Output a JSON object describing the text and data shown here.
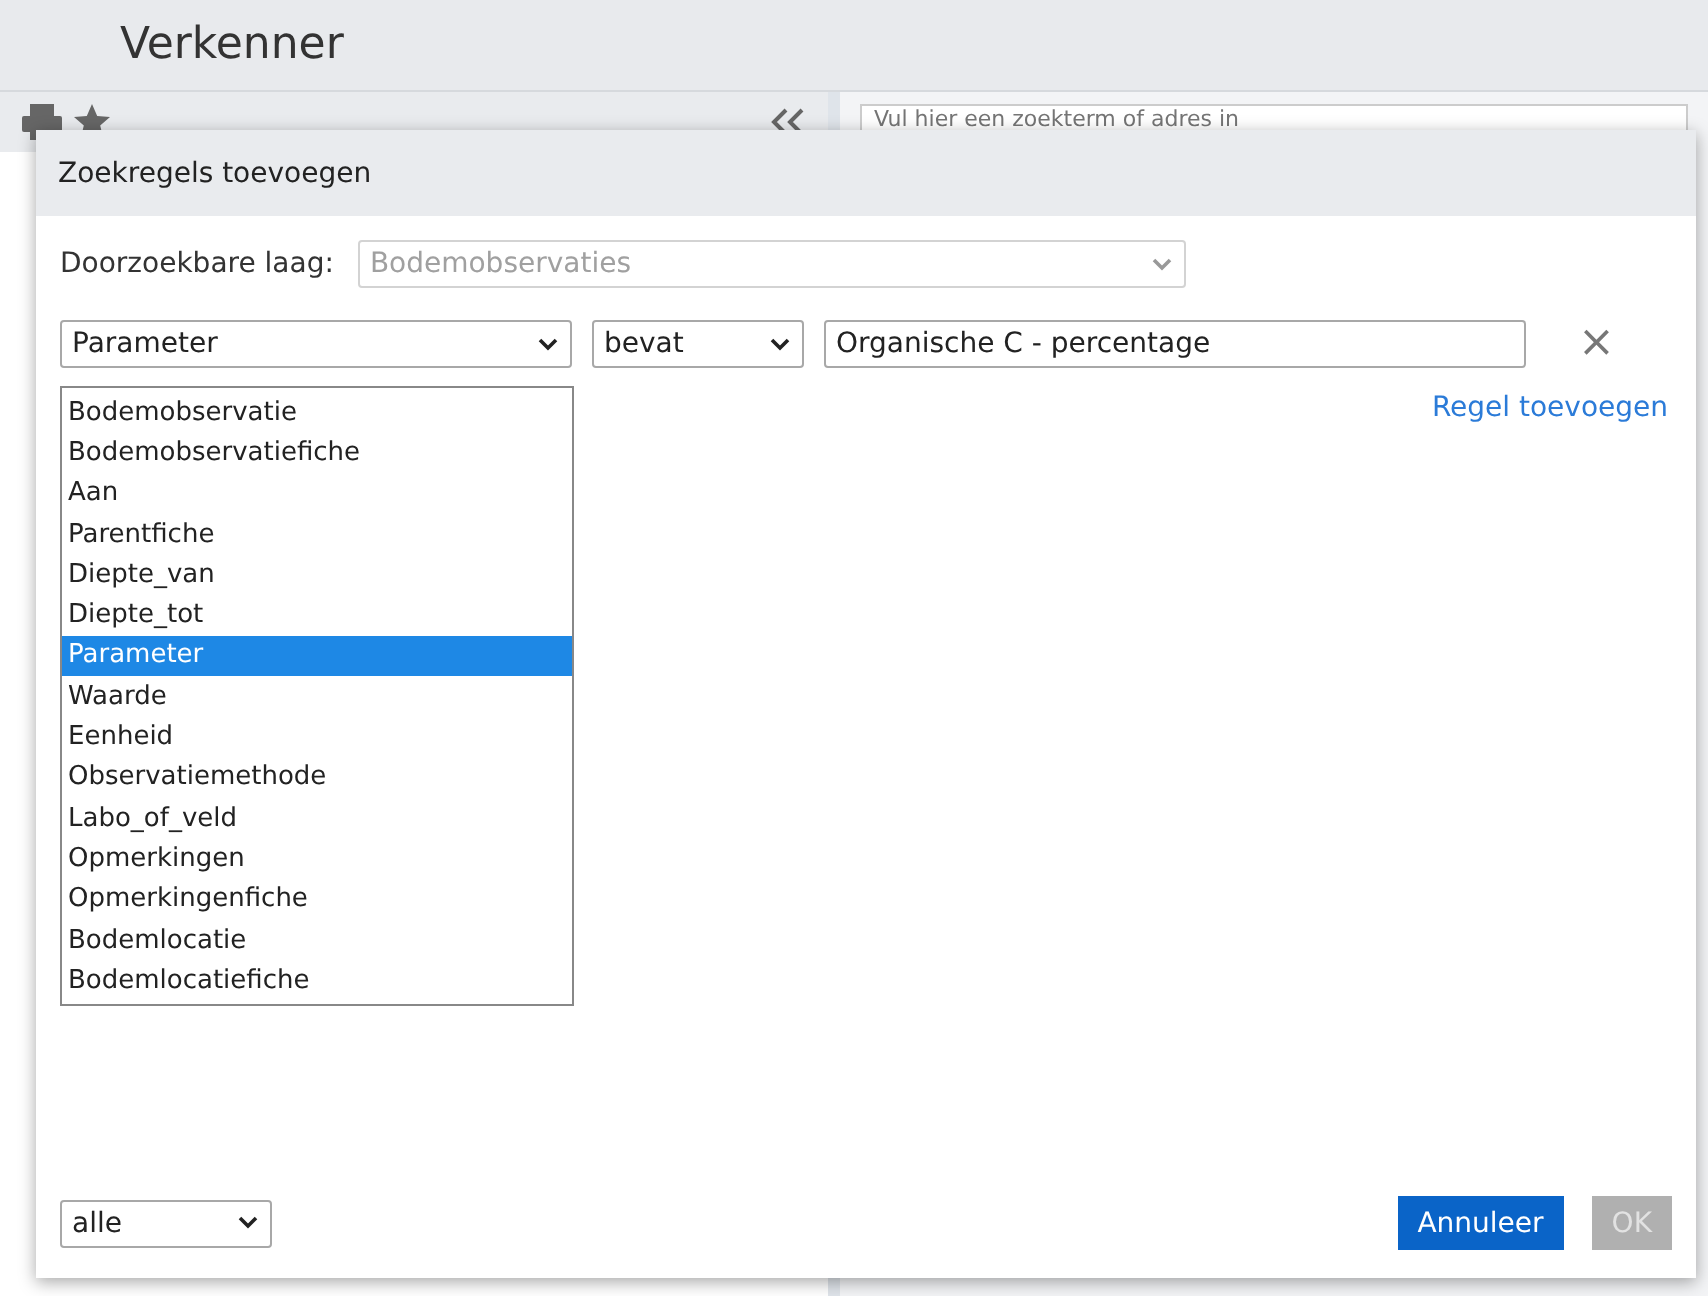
{
  "app": {
    "title": "Verkenner",
    "search": {
      "placeholder": "Vul hier een zoekterm of adres in"
    }
  },
  "dialog": {
    "title": "Zoekregels toevoegen",
    "layer": {
      "label": "Doorzoekbare laag:",
      "value": "Bodemobservaties",
      "disabled": true
    },
    "rule": {
      "field": "Parameter",
      "operator": "bevat",
      "value": "Organische C - percentage",
      "remove": "×"
    },
    "field_options": [
      {
        "label": "Bodemobservatie",
        "selected": false
      },
      {
        "label": "Bodemobservatiefiche",
        "selected": false
      },
      {
        "label": "Aan",
        "selected": false
      },
      {
        "label": "Parentfiche",
        "selected": false
      },
      {
        "label": "Diepte_van",
        "selected": false
      },
      {
        "label": "Diepte_tot",
        "selected": false
      },
      {
        "label": "Parameter",
        "selected": true
      },
      {
        "label": "Waarde",
        "selected": false
      },
      {
        "label": "Eenheid",
        "selected": false
      },
      {
        "label": "Observatiemethode",
        "selected": false
      },
      {
        "label": "Labo_of_veld",
        "selected": false
      },
      {
        "label": "Opmerkingen",
        "selected": false
      },
      {
        "label": "Opmerkingenfiche",
        "selected": false
      },
      {
        "label": "Bodemlocatie",
        "selected": false
      },
      {
        "label": "Bodemlocatiefiche",
        "selected": false
      }
    ],
    "add_rule": "Regel toevoegen",
    "match": "alle",
    "buttons": [
      {
        "label": "Annuleer",
        "disabled": false
      },
      {
        "label": "OK",
        "disabled": true
      }
    ]
  }
}
